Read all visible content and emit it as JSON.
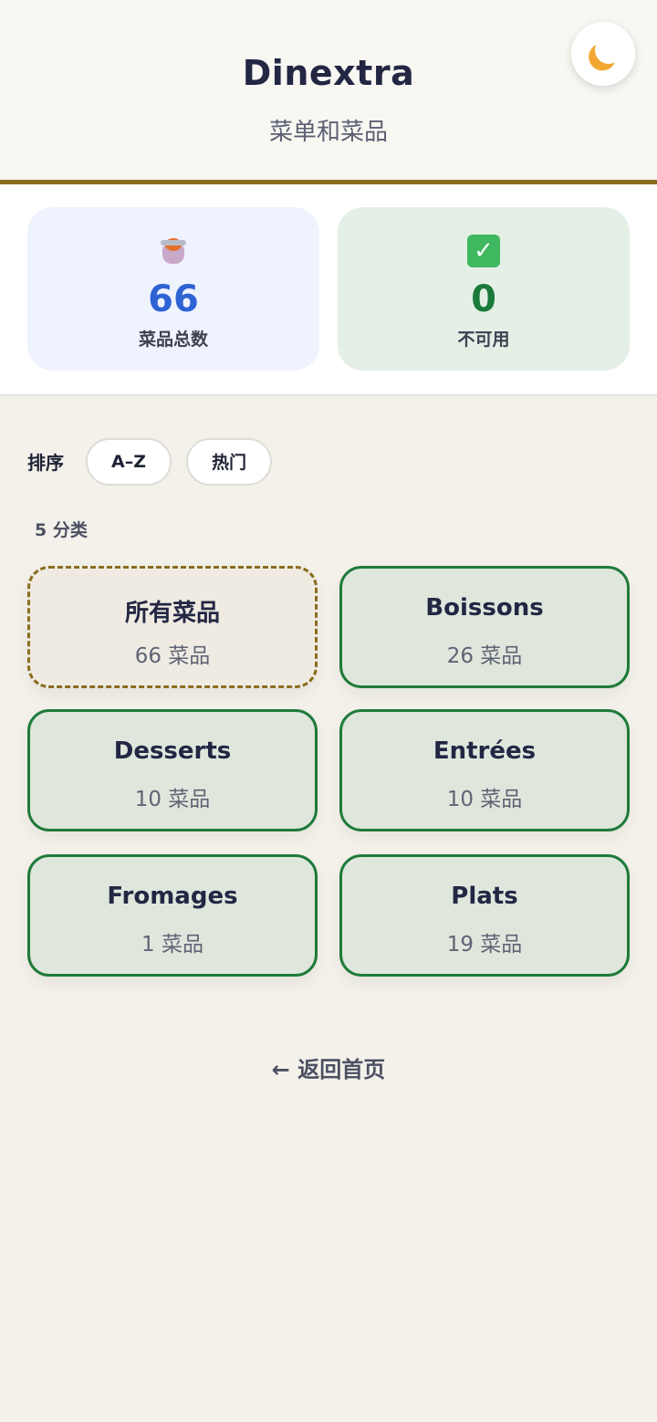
{
  "header": {
    "title": "Dinextra",
    "subtitle": "菜单和菜品",
    "theme_icon": "moon-icon"
  },
  "stats": [
    {
      "icon": "cooking-pot-icon",
      "value": "66",
      "label": "菜品总数",
      "color": "#2e63d4"
    },
    {
      "icon": "check-mark-icon",
      "value": "0",
      "label": "不可用",
      "color": "#1a7a3a"
    }
  ],
  "sort": {
    "label": "排序",
    "options": [
      "A–Z",
      "热门"
    ]
  },
  "categories_count": "5 分类",
  "categories": [
    {
      "name": "所有菜品",
      "items": "66 菜品",
      "style": "all"
    },
    {
      "name": "Boissons",
      "items": "26 菜品"
    },
    {
      "name": "Desserts",
      "items": "10 菜品"
    },
    {
      "name": "Entrées",
      "items": "10 菜品"
    },
    {
      "name": "Fromages",
      "items": "1 菜品"
    },
    {
      "name": "Plats",
      "items": "19 菜品"
    }
  ],
  "back_link": "← 返回首页",
  "colors": {
    "accent_gold": "#8a6d1e",
    "category_green": "#1f7a3a",
    "primary_blue": "#2e63d4"
  }
}
